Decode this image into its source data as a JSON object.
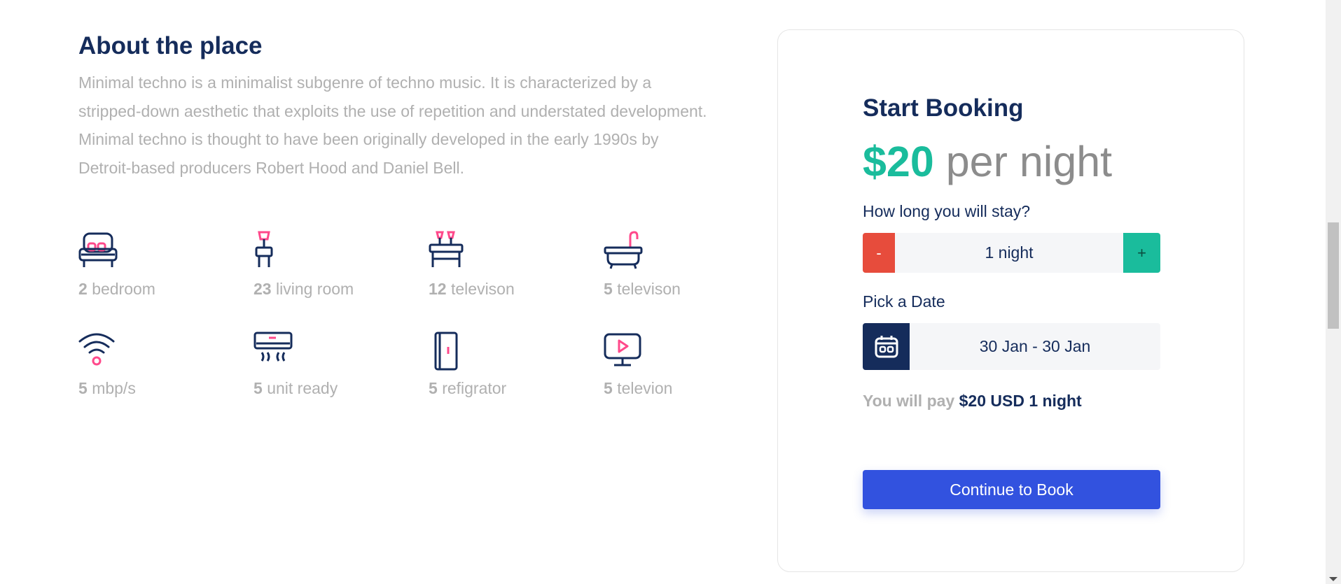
{
  "about": {
    "title": "About the place",
    "description": "Minimal techno is a minimalist subgenre of techno music. It is characterized by a stripped-down aesthetic that exploits the use of repetition and understated development. Minimal techno is thought to have been originally developed in the early 1990s by Detroit-based producers Robert Hood and Daniel Bell."
  },
  "features": [
    {
      "count": "2",
      "label": "bedroom",
      "icon": "bed-icon"
    },
    {
      "count": "23",
      "label": "living room",
      "icon": "living-room-icon"
    },
    {
      "count": "12",
      "label": "televison",
      "icon": "table-icon"
    },
    {
      "count": "5",
      "label": "televison",
      "icon": "bathtub-icon"
    },
    {
      "count": "5",
      "label": "mbp/s",
      "icon": "wifi-icon"
    },
    {
      "count": "5",
      "label": "unit ready",
      "icon": "air-conditioner-icon"
    },
    {
      "count": "5",
      "label": "refigrator",
      "icon": "refrigerator-icon"
    },
    {
      "count": "5",
      "label": "televion",
      "icon": "television-icon"
    }
  ],
  "booking": {
    "title": "Start Booking",
    "price": "$20",
    "per": "per night",
    "duration_question": "How long you will stay?",
    "minus_label": "-",
    "plus_label": "+",
    "duration_value": "1 night",
    "date_question": "Pick a Date",
    "date_value": "30 Jan - 30 Jan",
    "pay_label": "You will pay",
    "pay_value": "$20 USD 1 night",
    "cta_label": "Continue to Book"
  },
  "colors": {
    "navy": "#152c5b",
    "accent_green": "#1abc9c",
    "accent_red": "#e74c3c",
    "accent_pink": "#ff498b",
    "primary_blue": "#3252df",
    "muted_gray": "#b0b0b0"
  }
}
